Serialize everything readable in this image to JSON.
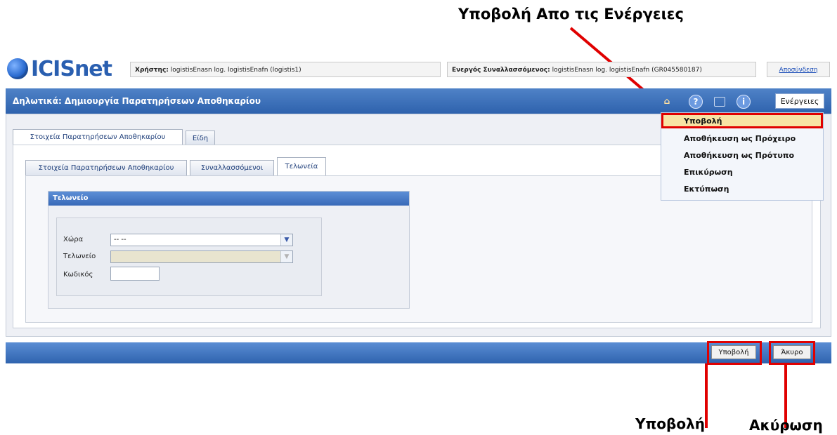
{
  "annotations": {
    "actions_submit": "Υποβολή Απο τις Ενέργειες",
    "submit": "Υποβολή",
    "cancel": "Ακύρωση"
  },
  "header": {
    "logo_text": "ICISnet",
    "user_label": "Χρήστης:",
    "user_value": "logistisEnasn log. logistisEnafn (logistis1)",
    "operator_label": "Ενεργός Συναλλασσόμενος:",
    "operator_value": "logistisEnasn log. logistisEnafn (GR045580187)",
    "logout": "Αποσύνδεση"
  },
  "titlebar": {
    "title": "Δηλωτικά: Δημιουργία Παρατηρήσεων Αποθηκαρίου",
    "actions_button": "Ενέργειες"
  },
  "actions_menu": {
    "items": [
      "Υποβολή",
      "Αποθήκευση ως Πρόχειρο",
      "Αποθήκευση ως Πρότυπο",
      "Επικύρωση",
      "Εκτύπωση"
    ]
  },
  "outer_tabs": [
    "Στοιχεία Παρατηρήσεων Αποθηκαρίου",
    "Είδη"
  ],
  "inner_tabs": [
    "Στοιχεία Παρατηρήσεων Αποθηκαρίου",
    "Συναλλασσόμενοι",
    "Τελωνεία"
  ],
  "section": {
    "title": "Τελωνείο",
    "country_label": "Χώρα",
    "country_value": "-- --",
    "customs_label": "Τελωνείο",
    "customs_value": "",
    "code_label": "Κωδικός",
    "code_value": ""
  },
  "footer": {
    "submit": "Υποβολή",
    "cancel": "Άκυρο"
  },
  "colors": {
    "titlebar": "#2e62ad",
    "highlight": "#e00000"
  }
}
